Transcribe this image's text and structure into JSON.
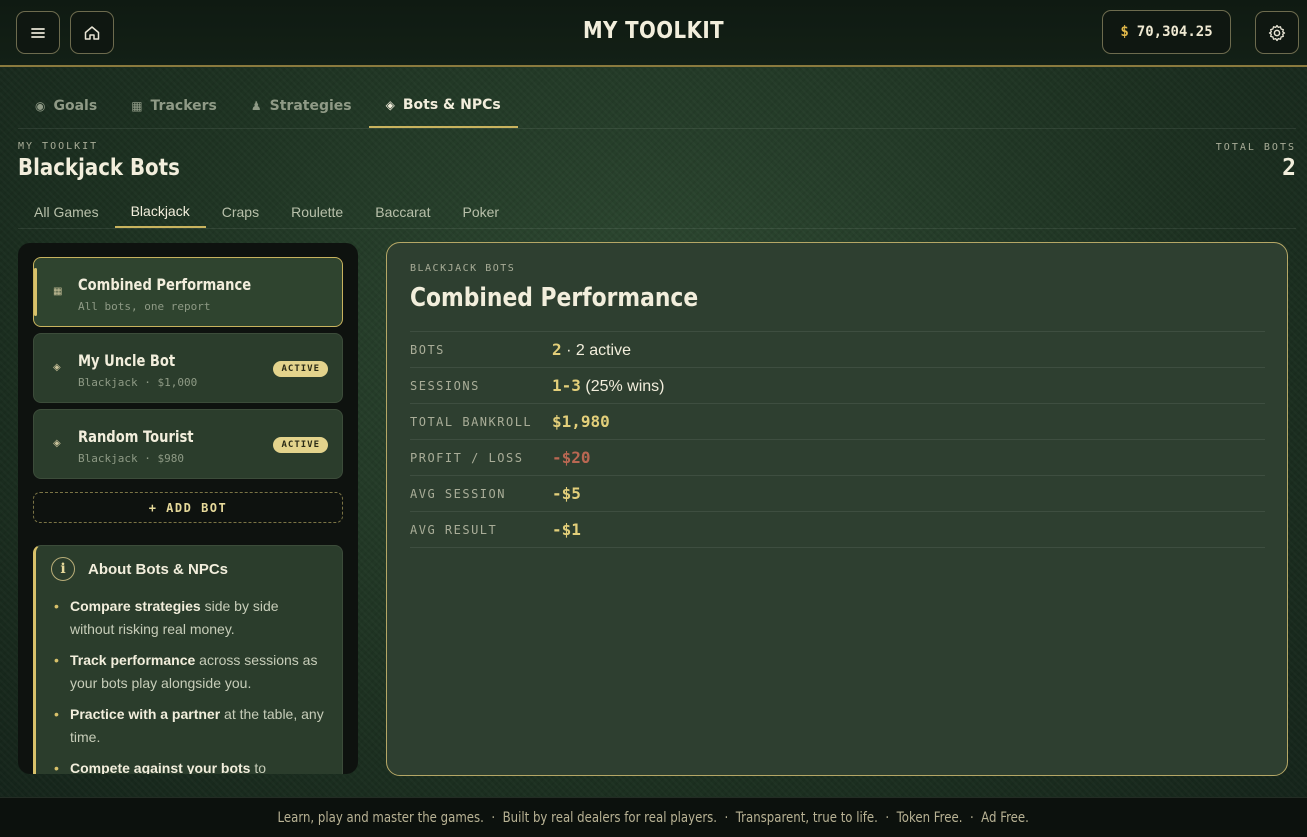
{
  "header": {
    "title": "MY TOOLKIT",
    "balance_currency": "$",
    "balance_value": "70,304.25"
  },
  "main_tabs": [
    {
      "icon": "◉",
      "label": "Goals",
      "active": false
    },
    {
      "icon": "▦",
      "label": "Trackers",
      "active": false
    },
    {
      "icon": "♟",
      "label": "Strategies",
      "active": false
    },
    {
      "icon": "◈",
      "label": "Bots & NPCs",
      "active": true
    }
  ],
  "page": {
    "crumb": "MY TOOLKIT",
    "title": "Blackjack Bots",
    "total_label": "TOTAL BOTS",
    "total_value": "2"
  },
  "game_tabs": [
    {
      "label": "All Games",
      "active": false
    },
    {
      "label": "Blackjack",
      "active": true
    },
    {
      "label": "Craps",
      "active": false
    },
    {
      "label": "Roulette",
      "active": false
    },
    {
      "label": "Baccarat",
      "active": false
    },
    {
      "label": "Poker",
      "active": false
    }
  ],
  "sidebar": {
    "cards": [
      {
        "icon": "▦",
        "name": "Combined Performance",
        "sub": "All bots, one report",
        "badge": ""
      },
      {
        "icon": "◈",
        "name": "My Uncle Bot",
        "sub": "Blackjack · $1,000",
        "badge": "ACTIVE"
      },
      {
        "icon": "◈",
        "name": "Random Tourist",
        "sub": "Blackjack · $980",
        "badge": "ACTIVE"
      }
    ],
    "add_bot_label": "+ ADD BOT",
    "about": {
      "icon": "i",
      "title": "About Bots & NPCs",
      "items": [
        {
          "bold": "Compare strategies",
          "rest": " side by side without risking real money."
        },
        {
          "bold": "Track performance",
          "rest": " across sessions as your bots play alongside you."
        },
        {
          "bold": "Practice with a partner",
          "rest": " at the table, any time."
        },
        {
          "bold": "Compete against your bots",
          "rest": " to"
        }
      ]
    }
  },
  "panel": {
    "eyebrow": "BLACKJACK BOTS",
    "title": "Combined Performance",
    "stats": {
      "bots_label": "BOTS",
      "bots_value": "2",
      "bots_extra": "· 2 active",
      "sessions_label": "SESSIONS",
      "sessions_value": "1-3",
      "sessions_extra": "(25% wins)",
      "bankroll_label": "TOTAL BANKROLL",
      "bankroll_value": "$1,980",
      "pl_label": "PROFIT / LOSS",
      "pl_value": "-$20",
      "avg_session_label": "AVG SESSION",
      "avg_session_value": "-$5",
      "avg_result_label": "AVG RESULT",
      "avg_result_value": "-$1"
    }
  },
  "footer": {
    "text": "Learn, play and master the games.  ·  Built by real dealers for real players.  ·  Transparent, true to life.  ·  Token Free.  ·  Ad Free."
  },
  "colors": {
    "accent": "#c8b35e",
    "negative": "#b96752",
    "background": "#1f3323"
  }
}
